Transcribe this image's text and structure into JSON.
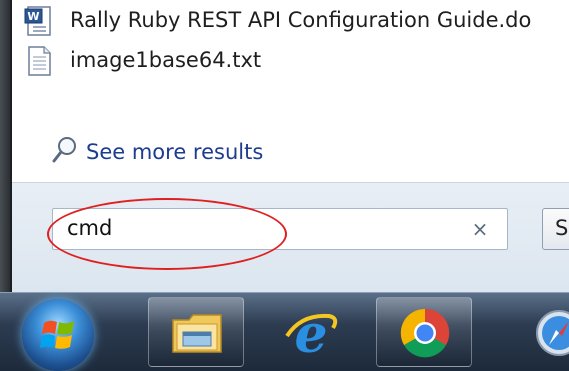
{
  "results": {
    "items": [
      {
        "label": "Rally Ruby REST API Configuration Guide.do",
        "icon": "word-document-icon"
      },
      {
        "label": "image1base64.txt",
        "icon": "text-file-icon"
      }
    ],
    "see_more": {
      "label": "See more results",
      "icon": "search-icon"
    }
  },
  "search": {
    "value": "cmd",
    "clear_glyph": "×",
    "action_label": "S"
  },
  "taskbar": {
    "items": [
      {
        "icon": "windows-start-orb-icon"
      },
      {
        "icon": "file-explorer-icon"
      },
      {
        "icon": "internet-explorer-icon"
      },
      {
        "icon": "chrome-icon"
      },
      {
        "icon": "safari-icon"
      }
    ]
  },
  "colors": {
    "link": "#1c3c8f",
    "highlight": "#e02020",
    "taskbar": "#2d3c51"
  }
}
